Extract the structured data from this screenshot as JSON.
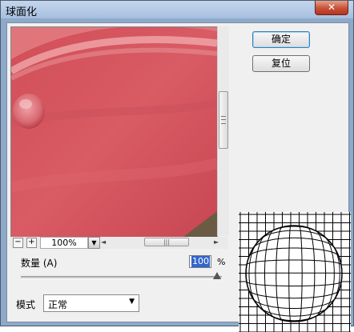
{
  "window": {
    "title": "球面化",
    "close_glyph": "✕"
  },
  "buttons": {
    "ok_label": "确定",
    "reset_label": "复位"
  },
  "zoom": {
    "minus": "−",
    "plus": "+",
    "value": "100%",
    "dropdown_glyph": "▼",
    "left_arrow": "◄",
    "right_arrow": "►",
    "thumb_grip": "|||"
  },
  "amount": {
    "label": "数量 (A)",
    "value": "100",
    "unit": "%",
    "slider_fraction": 1.0
  },
  "mode": {
    "label": "模式",
    "value": "正常",
    "arrow": "▼"
  },
  "colors": {
    "title_bar": "#b4c9e6",
    "preview_base": "#d05a65",
    "ok_border": "#3c7fb1"
  },
  "icons": [
    "close-icon",
    "zoom-out-icon",
    "zoom-in-icon",
    "dropdown-arrow-icon",
    "sphere-grid-icon"
  ]
}
